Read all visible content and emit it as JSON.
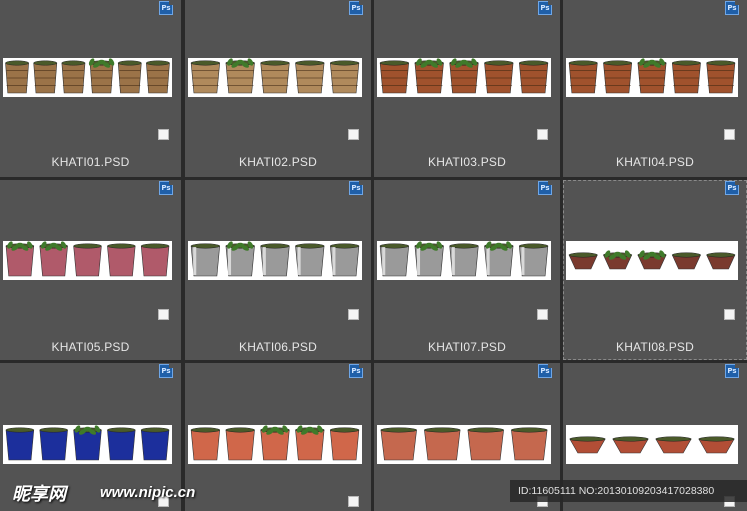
{
  "files": [
    {
      "name": "KHATI01.PSD",
      "kind": "wicker",
      "pots": 6,
      "plants": [
        3
      ]
    },
    {
      "name": "KHATI02.PSD",
      "kind": "wicker-large",
      "pots": 5,
      "plants": [
        1
      ]
    },
    {
      "name": "KHATI03.PSD",
      "kind": "wood-barrel",
      "pots": 5,
      "plants": [
        1,
        2
      ]
    },
    {
      "name": "KHATI04.PSD",
      "kind": "wood-barrel",
      "pots": 5,
      "plants": [
        2
      ]
    },
    {
      "name": "KHATI05.PSD",
      "kind": "pink-pot",
      "pots": 5,
      "plants": [
        0,
        1
      ]
    },
    {
      "name": "KHATI06.PSD",
      "kind": "steel",
      "pots": 5,
      "plants": [
        1
      ]
    },
    {
      "name": "KHATI07.PSD",
      "kind": "steel",
      "pots": 5,
      "plants": [
        1,
        3
      ]
    },
    {
      "name": "KHATI08.PSD",
      "kind": "brown-bowl",
      "pots": 5,
      "plants": [
        1,
        2
      ]
    },
    {
      "name": "",
      "kind": "blue-pot",
      "pots": 5,
      "plants": [
        2
      ]
    },
    {
      "name": "",
      "kind": "terracotta",
      "pots": 5,
      "plants": [
        2,
        3
      ]
    },
    {
      "name": "",
      "kind": "terracotta-pattern",
      "pots": 4,
      "plants": []
    },
    {
      "name": "",
      "kind": "terracotta-bowl",
      "pots": 4,
      "plants": []
    }
  ],
  "selected_index": 7,
  "file_type_badge": "Ps",
  "colors": {
    "wicker": "#9b7348",
    "wicker-large": "#b08a5c",
    "wood-barrel": "#a0522d",
    "pink-pot": "#b05a6a",
    "steel": "#9a9a9a",
    "brown-bowl": "#7a3a2e",
    "blue-pot": "#1c2f9c",
    "terracotta": "#d0674a",
    "terracotta-pattern": "#c5684e",
    "terracotta-bowl": "#b24e36",
    "plant": "#3f7a2a",
    "soil": "#4a5a2a"
  },
  "watermark": {
    "logo": "昵享网",
    "url": "www.nipic.cn",
    "id_text": "ID:11605111 NO:20130109203417028380"
  }
}
